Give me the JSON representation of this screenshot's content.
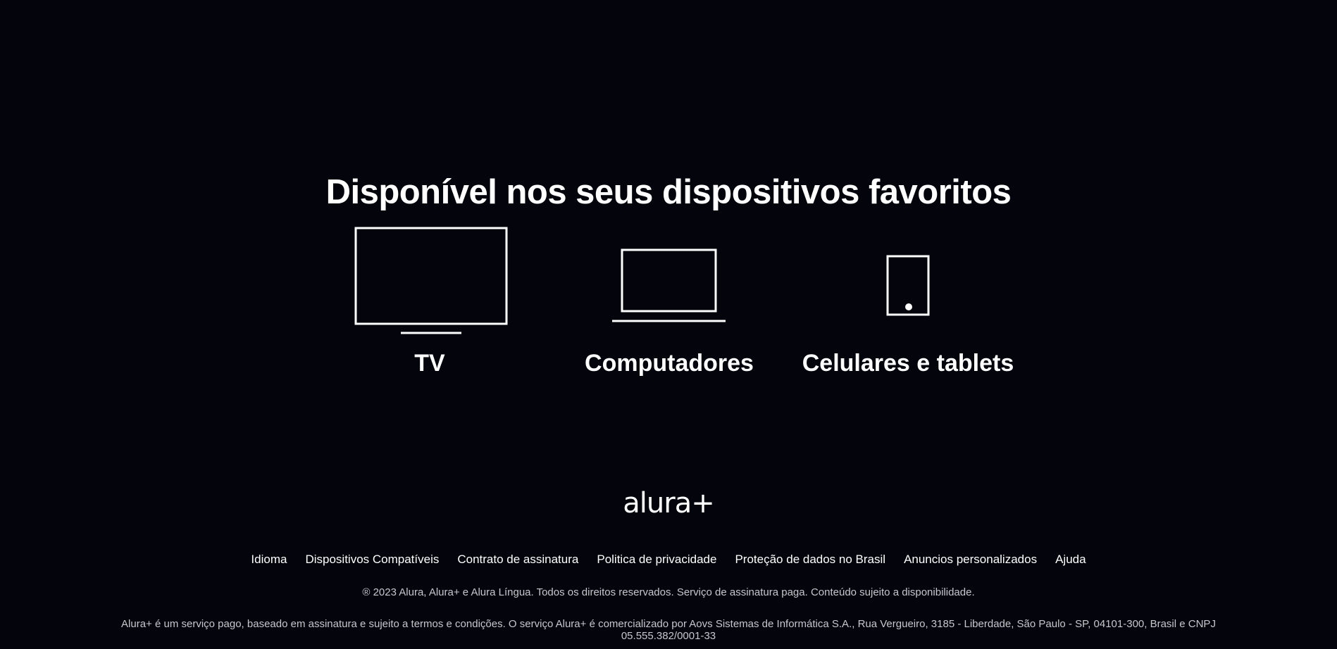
{
  "devices_section": {
    "title": "Disponível nos seus dispositivos favoritos",
    "devices": [
      {
        "label": "TV",
        "icon": "tv-icon"
      },
      {
        "label": "Computadores",
        "icon": "laptop-icon"
      },
      {
        "label": "Celulares e tablets",
        "icon": "tablet-icon"
      }
    ]
  },
  "footer": {
    "logo_text": "alura+",
    "links": [
      "Idioma",
      "Dispositivos Compatíveis",
      "Contrato de assinatura",
      "Politica de privacidade",
      "Proteção de dados no Brasil",
      "Anuncios personalizados",
      "Ajuda"
    ],
    "copyright": "® 2023 Alura, Alura+ e Alura Língua. Todos os direitos reservados. Serviço de assinatura paga. Conteúdo sujeito a disponibilidade.",
    "legal": "Alura+ é um serviço pago, baseado em assinatura e sujeito a termos e condições. O serviço Alura+ é comercializado por Aovs Sistemas de Informática S.A., Rua Vergueiro, 3185 - Liberdade, São Paulo - SP, 04101-300, Brasil e CNPJ 05.555.382/0001-33"
  },
  "colors": {
    "background": "#03040c",
    "text": "#ffffff",
    "muted_text": "#c7c8cc"
  }
}
